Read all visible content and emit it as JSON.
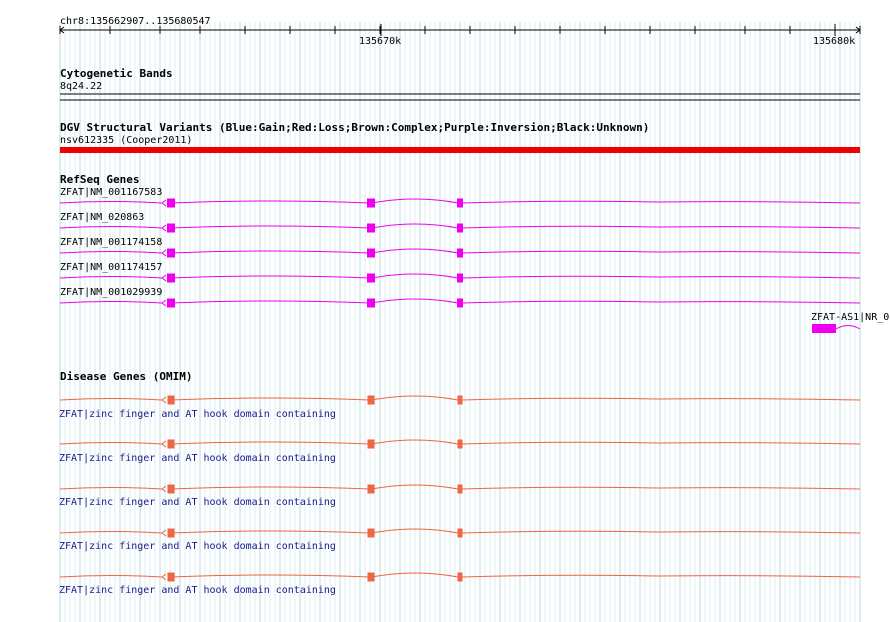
{
  "ruler": {
    "location": "chr8:135662907..135680547",
    "ticks": [
      {
        "label": "135670k",
        "bp": 135670000
      },
      {
        "label": "135680k",
        "bp": 135680000
      }
    ]
  },
  "cytoband": {
    "title": "Cytogenetic Bands",
    "band": "8q24.22"
  },
  "dgv": {
    "title": "DGV Structural Variants (Blue:Gain;Red:Loss;Brown:Complex;Purple:Inversion;Black:Unknown)",
    "variant": "nsv612335 (Cooper2011)",
    "variant_color": "#ee0000"
  },
  "refseq": {
    "title": "RefSeq Genes",
    "color": "#ee00ee",
    "transcripts": [
      "ZFAT|NM_001167583",
      "ZFAT|NM_020863",
      "ZFAT|NM_001174158",
      "ZFAT|NM_001174157",
      "ZFAT|NM_001029939"
    ],
    "extra_gene": "ZFAT-AS1|NR_0"
  },
  "omim": {
    "title": "Disease Genes (OMIM)",
    "color": "#ee6644",
    "entries": [
      "ZFAT|zinc finger and AT hook domain containing",
      "ZFAT|zinc finger and AT hook domain containing",
      "ZFAT|zinc finger and AT hook domain containing",
      "ZFAT|zinc finger and AT hook domain containing",
      "ZFAT|zinc finger and AT hook domain containing"
    ]
  }
}
